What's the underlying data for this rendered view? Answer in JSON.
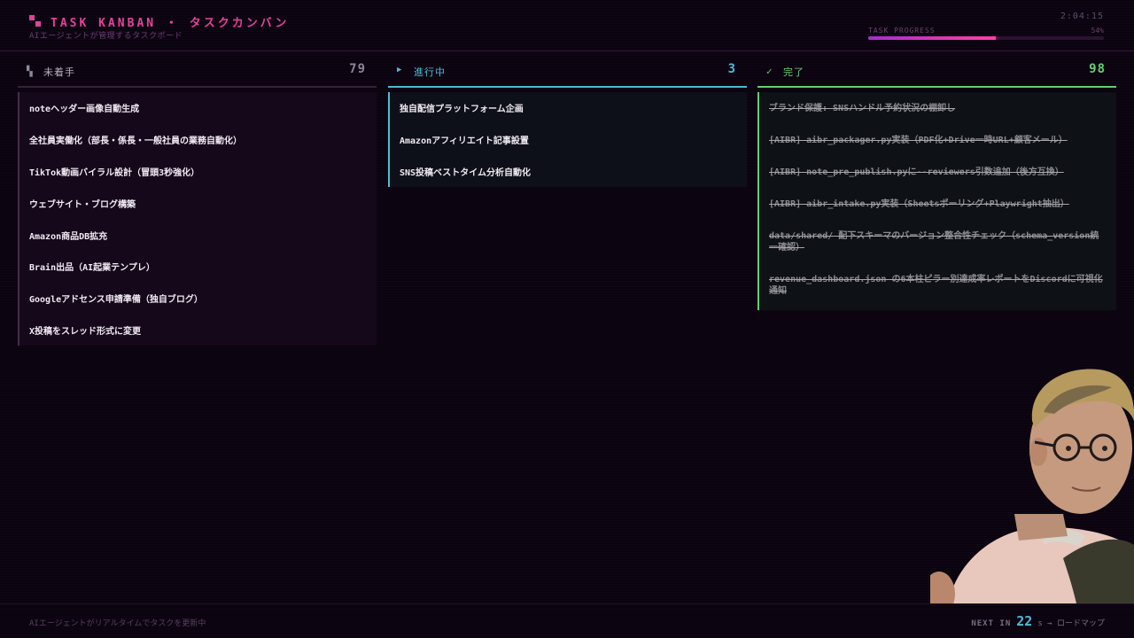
{
  "header": {
    "title": "TASK KANBAN ・ タスクカンバン",
    "subtitle": "AIエージェントが管理するタスクボード",
    "clock": "2:04:15",
    "progress_label": "TASK PROGRESS",
    "progress_text": "54%",
    "progress_value": 0.54,
    "accent_color": "#e6409c"
  },
  "columns": {
    "todo": {
      "icon": "grid-icon",
      "title": "未着手",
      "count": "79",
      "cards": [
        "noteヘッダー画像自動生成",
        "全社員実働化（部長・係長・一般社員の業務自動化）",
        "TikTok動画バイラル設計（冒頭3秒強化）",
        "ウェブサイト・ブログ構築",
        "Amazon商品DB拡充",
        "Brain出品（AI起業テンプレ）",
        "Googleアドセンス申請準備（独自ブログ）",
        "X投稿をスレッド形式に変更"
      ]
    },
    "doing": {
      "icon": "play-icon",
      "title": "進行中",
      "count": "3",
      "color": "#4fb9d4",
      "cards": [
        "独自配信プラットフォーム企画",
        "Amazonアフィリエイト記事設置",
        "SNS投稿ベストタイム分析自動化"
      ]
    },
    "done": {
      "icon": "check-icon",
      "title": "完了",
      "count": "98",
      "color": "#62cf72",
      "cards": [
        "ブランド保護: SNSハンドル予約状況の棚卸し",
        "[AIBR] aibr_packager.py実装（PDF化+Drive一時URL+顧客メール）",
        "[AIBR] note_pre_publish.pyに--reviewers引数追加（後方互換）",
        "[AIBR] aibr_intake.py実装（Sheetsポーリング+Playwright抽出）",
        "data/shared/ 配下スキーマのバージョン整合性チェック（schema_version統一確認）",
        "revenue_dashboard.json の6本柱ピラー別達成率レポートをDiscordに可視化通知"
      ]
    }
  },
  "footer": {
    "note": "AIエージェントがリアルタイムでタスクを更新中",
    "next_label": "NEXT IN",
    "next_seconds": "22",
    "next_suffix": "s → ロードマップ"
  }
}
